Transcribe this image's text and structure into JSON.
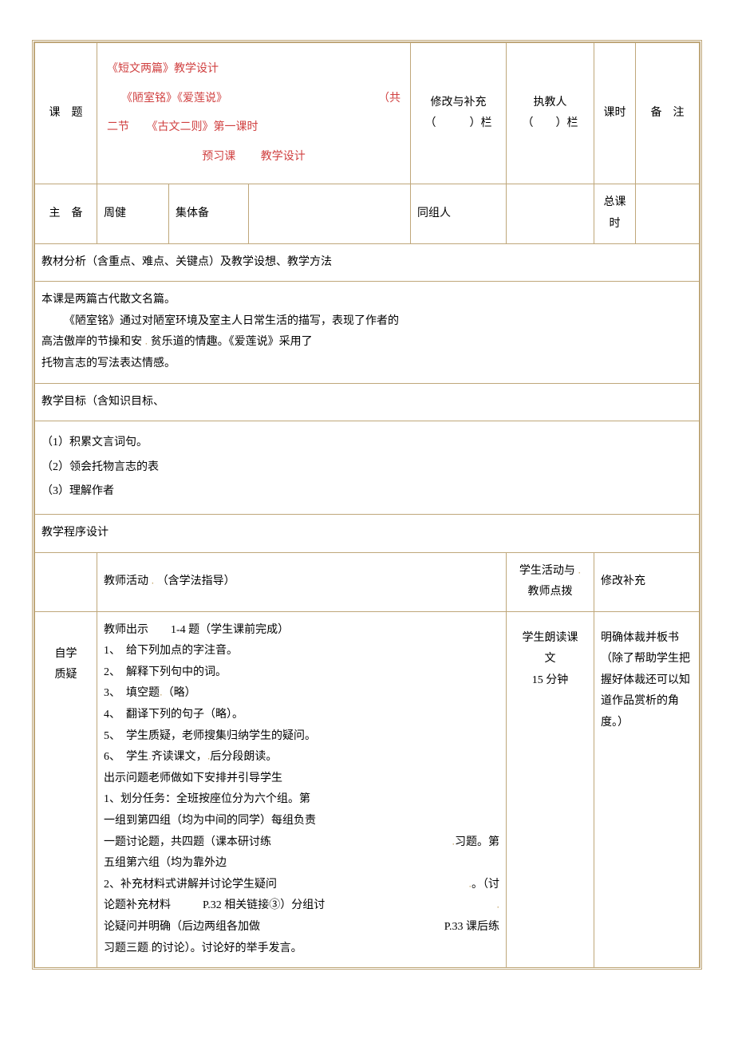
{
  "header": {
    "col1_label": "课　题",
    "title_line1": "《短文两篇》教学设计",
    "title_line2_left": "《陋室铭》《爱莲说》",
    "title_line2_right": "（共",
    "title_line3_left": "二节",
    "title_line3_right": "《古文二则》第一课时",
    "title_line4_center_left": "预习课",
    "title_line4_center_right": "教学设计",
    "col3_line1": "修改与补充",
    "col3_line2": "（　　　）栏",
    "col4_line1": "执教人",
    "col4_line2": "（　　）栏",
    "col5": "课时",
    "col6": "备　注"
  },
  "row2": {
    "c1": "主　备",
    "c2": "周健",
    "c3": "集体备",
    "c4": "同组人",
    "c5": "总课时"
  },
  "analysis": {
    "title": "教材分析（含重点、难点、关键点）及教学设想、教学方法",
    "p1": "本课是两篇古代散文名篇。",
    "p2": "《陋室铭》通过对陋室环境及室主人日常生活的描写，表现了作者的",
    "p3_left": "高洁傲岸的节操和安",
    "p3_right": "贫乐道的情趣。《爱莲说》采用了",
    "p4": "托物言志的写法表达情感。"
  },
  "objectives": {
    "title": "教学目标（含知识目标、",
    "line1_prefix": "（1）",
    "line1": "积累文言词句。",
    "line2_prefix": "（2）",
    "line2": "领会托物言志的表",
    "line3_prefix": "（3）",
    "line3": "理解作者"
  },
  "process": {
    "title": "教学程序设计",
    "hdr_col2_left": "教师活动",
    "hdr_col2_right": "（含学法指导）",
    "hdr_col3_line1": "学生活动与",
    "hdr_col3_line2": "教师点拨",
    "hdr_col4": "修改补充",
    "rowlabel1": "自学",
    "rowlabel2": "质疑",
    "c2_title": "教师出示　　1-4 题（学生课前完成）",
    "c2_l1_num": "1、",
    "c2_l1": "　给下列加点的字注音。",
    "c2_l2_num": "2、",
    "c2_l2": "　解释下列句中的词。",
    "c2_l3_num": "3、",
    "c2_l3_a": "　填空题",
    "c2_l3_b": "（略）",
    "c2_l4_num": "4、",
    "c2_l4": "　翻译下列的句子（略）。",
    "c2_l5_num": "5、",
    "c2_l5": "　学生质疑，老师搜集归纳学生的疑问。",
    "c2_l6_num": "6、",
    "c2_l6_a": "　学生",
    "c2_l6_b": "齐读课文，",
    "c2_l6_c": "后分段朗读。",
    "c2_block2_title": "出示问题老师做如下安排并引导学生",
    "c2_b2_l1": "1、划分任务：全班按座位分为六个组。第",
    "c2_b2_l2": "一组到第四组（均为中间的同学）每组负责",
    "c2_b2_l3_left": "一题讨论题，共四题（课本研讨练",
    "c2_b2_l3_right": "习题。第",
    "c2_b2_l4": "五组第六组（均为靠外边",
    "c2_b2_l5_left": "2、补充材料式讲解并讨论学生疑问",
    "c2_b2_l5_right": "。（讨",
    "c2_b2_l6_left": "论题补充材料",
    "c2_b2_l6_mid": "P.32 相关链接③）分组讨",
    "c2_b2_l6_right": "",
    "c2_b2_l7_left": "论疑问并明确（后边两组各加做",
    "c2_b2_l7_right": "P.33 课后练",
    "c2_b2_l8_left": "习题三题",
    "c2_b2_l8_right": "的讨论）。讨论好的举手发言。",
    "c3_line1": "学生朗读课",
    "c3_line2": "文",
    "c3_line3": "15 分钟",
    "c4_l1": "明确体裁并板书",
    "c4_l2": "（除了帮助学生把",
    "c4_l3": "握好体裁还可以知",
    "c4_l4": "道作品赏析的角",
    "c4_l5": "度。）"
  }
}
